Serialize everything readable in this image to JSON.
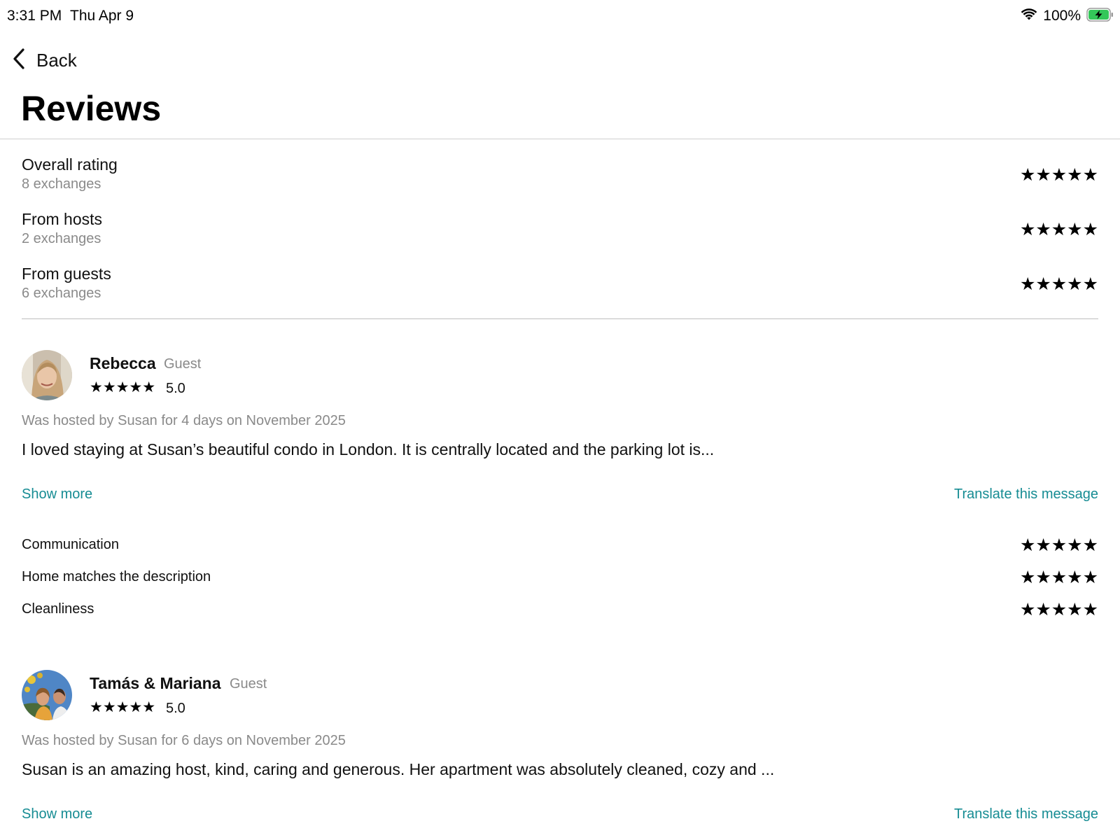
{
  "status_bar": {
    "time": "3:31 PM",
    "date": "Thu Apr 9",
    "battery_percent": "100%",
    "icons": [
      "wifi-icon",
      "battery-charging-icon"
    ]
  },
  "nav": {
    "back_label": "Back",
    "back_icon": "chevron-left-icon"
  },
  "page": {
    "title": "Reviews"
  },
  "rating_summary": [
    {
      "label": "Overall rating",
      "sub": "8 exchanges",
      "stars": "★★★★★"
    },
    {
      "label": "From hosts",
      "sub": "2 exchanges",
      "stars": "★★★★★"
    },
    {
      "label": "From guests",
      "sub": "6 exchanges",
      "stars": "★★★★★"
    }
  ],
  "reviews": [
    {
      "name": "Rebecca",
      "role": "Guest",
      "stars": "★★★★★",
      "score": "5.0",
      "stay_info": "Was hosted by Susan for 4 days on November 2025",
      "text": "I loved staying at Susan’s beautiful condo in London. It is centrally located and the parking lot is...",
      "show_more": "Show more",
      "translate": "Translate this message",
      "categories": [
        {
          "label": "Communication",
          "stars": "★★★★★"
        },
        {
          "label": "Home matches the description",
          "stars": "★★★★★"
        },
        {
          "label": "Cleanliness",
          "stars": "★★★★★"
        }
      ]
    },
    {
      "name": "Tamás & Mariana",
      "role": "Guest",
      "stars": "★★★★★",
      "score": "5.0",
      "stay_info": "Was hosted by Susan for 6 days on November 2025",
      "text": "Susan is an amazing host, kind, caring and generous. Her apartment was absolutely cleaned, cozy and ...",
      "show_more": "Show more",
      "translate": "Translate this message"
    }
  ],
  "colors": {
    "link": "#168c93",
    "secondary_text": "#8a8a8a",
    "battery_fill": "#34c759"
  }
}
